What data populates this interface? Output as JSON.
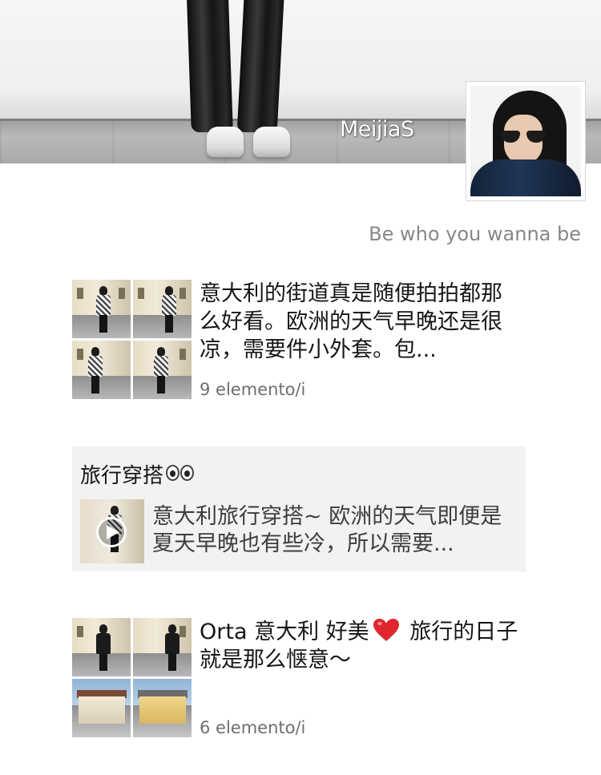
{
  "profile": {
    "name": "MeijiaS",
    "signature": "Be who you wanna be"
  },
  "posts": [
    {
      "text": "意大利的街道真是随便拍拍都那么好看。欧洲的天气早晚还是很凉，需要件小外套。包...",
      "count": "9 elemento/i"
    },
    {
      "title": "旅行穿搭",
      "shared_text": "意大利旅行穿搭~ 欧洲的天气即便是夏天早晚也有些冷，所以需要..."
    },
    {
      "text_before": "Orta 意大利 好美",
      "text_after": " 旅行的日子就是那么惬意～",
      "count": "6 elemento/i"
    }
  ],
  "icons": {
    "title_emoji": "eyes-icon",
    "heart": "heart-icon",
    "play": "play-icon"
  },
  "colors": {
    "heart": "#e0262f",
    "card_bg": "#f2f2f2",
    "muted_text": "#878787"
  }
}
